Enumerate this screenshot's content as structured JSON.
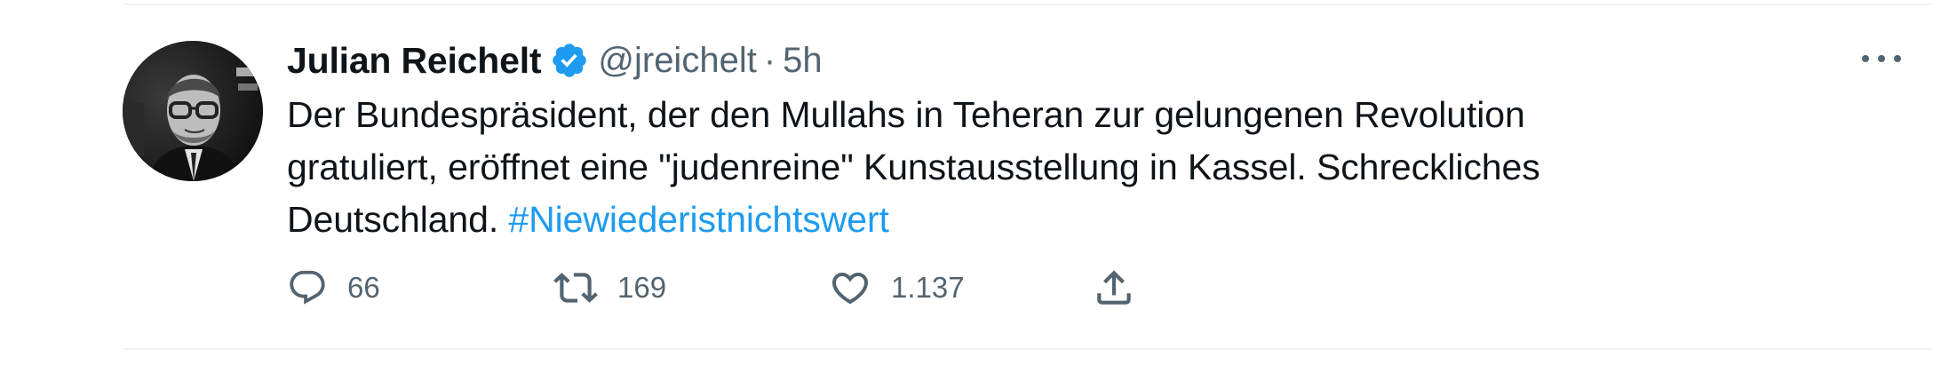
{
  "tweet": {
    "display_name": "Julian Reichelt",
    "handle": "@jreichelt",
    "separator": "·",
    "time": "5h",
    "text_lines": [
      "Der Bundespräsident, der den Mullahs in Teheran zur gelungenen Revolution",
      "gratuliert, eröffnet eine \"judenreine\" Kunstausstellung in Kassel. Schreckliches",
      "Deutschland."
    ],
    "hashtag": "#Niewiederistnichtswert",
    "actions": {
      "reply_count": "66",
      "retweet_count": "169",
      "like_count": "1.137"
    }
  },
  "icons": {
    "verified": "verified-badge-icon",
    "more": "more-options-icon",
    "reply": "reply-icon",
    "retweet": "retweet-icon",
    "like": "heart-icon",
    "share": "share-icon"
  },
  "colors": {
    "text_primary": "#0f1419",
    "text_secondary": "#536471",
    "accent": "#1d9bf0",
    "divider": "#eff3f4"
  }
}
